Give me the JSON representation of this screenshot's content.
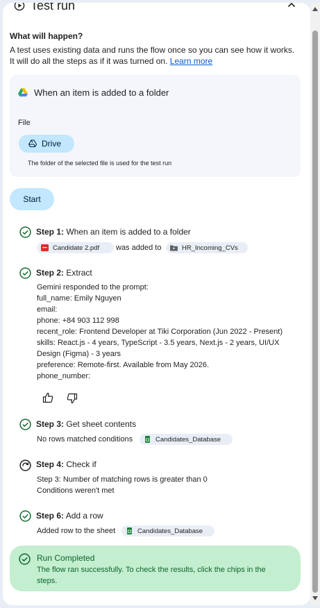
{
  "header": {
    "title": "Test run",
    "play_icon": "play-circle-icon",
    "collapse_icon": "chevron-up-icon"
  },
  "what": {
    "title": "What will happen?",
    "description": "A test uses existing data and runs the flow once so you can see how it works. It will do all the steps as if it was turned on.",
    "learn_more": "Learn more"
  },
  "trigger": {
    "title": "When an item is added to a folder",
    "file_label": "File",
    "chip_label": "Drive",
    "hint": "The folder of the selected file is used for the test run"
  },
  "start_label": "Start",
  "steps": [
    {
      "number": "Step 1:",
      "name": "When an item is added to a folder",
      "status": "success",
      "file_chip": "Candidate 2.pdf",
      "connector": "was added to",
      "folder_chip": "HR_Incoming_CVs"
    },
    {
      "number": "Step 2:",
      "name": "Extract",
      "status": "success",
      "lines": [
        "Gemini responded to the prompt:",
        "full_name: Emily Nguyen",
        "email:",
        "phone: +84 903 112 998",
        "recent_role: Frontend Developer at Tiki Corporation (Jun 2022 - Present)",
        "skills: React.js - 4 years, TypeScript - 3.5 years, Next.js - 2 years, UI/UX",
        "Design (Figma) - 3 years",
        "preference: Remote-first. Available from May 2026.",
        "phone_number:"
      ]
    },
    {
      "number": "Step 3:",
      "name": "Get sheet contents",
      "status": "success",
      "text": "No rows matched conditions",
      "sheet_chip": "Candidates_Database"
    },
    {
      "number": "Step 4:",
      "name": "Check if",
      "status": "skipped",
      "lines": [
        "Step 3: Number of matching rows is greater than 0",
        "Conditions weren't met"
      ]
    },
    {
      "number": "Step 6:",
      "name": "Add a row",
      "status": "success",
      "text": "Added row to the sheet",
      "sheet_chip": "Candidates_Database"
    }
  ],
  "completed": {
    "title": "Run Completed",
    "text": "The flow ran successfully. To check the results, click the chips in the steps."
  },
  "colors": {
    "accent_chip": "#c2e7ff",
    "success": "#146c2e",
    "completed_bg": "#c4eed0",
    "link": "#0b57d0",
    "pdf_red": "#d93025",
    "sheets_green": "#188038"
  }
}
